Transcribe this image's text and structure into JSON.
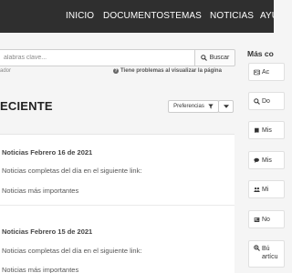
{
  "nav": {
    "items": [
      "INICIO",
      "DOCUMENTOS",
      "TEMAS",
      "NOTICIAS",
      "AYU"
    ]
  },
  "search": {
    "placeholder": "alabras clave...",
    "button_label": "Buscar",
    "hint": "ador",
    "problem_link": "Tiene problemas al visualizar la página"
  },
  "section": {
    "title": "ECIENTE",
    "preferences_label": "Preferencias"
  },
  "cards": [
    {
      "title": "Noticias Febrero 16 de 2021",
      "line1": "Noticias completas del día en el siguiente link:",
      "line2": "Noticias más importantes"
    },
    {
      "title": "Noticias Febrero 15 de 2021",
      "line1": "Noticias completas del día en el siguiente link:",
      "line2": "Noticias más importantes"
    }
  ],
  "sidebar": {
    "title": "Más co",
    "items": [
      {
        "label": "Ac",
        "icon": "id-card-icon"
      },
      {
        "label": "Do",
        "icon": "search-icon"
      },
      {
        "label": "Mis",
        "icon": "book-icon"
      },
      {
        "label": "Mis",
        "icon": "comments-icon"
      },
      {
        "label": "Mi",
        "icon": "users-icon"
      },
      {
        "label": "No",
        "icon": "newspaper-icon"
      },
      {
        "label": "Bú",
        "label2": "artícu",
        "icon": "search-plus-icon"
      }
    ]
  },
  "colors": {
    "navbar": "#2f2f2f",
    "background": "#f5f5f5",
    "card": "#ffffff"
  }
}
